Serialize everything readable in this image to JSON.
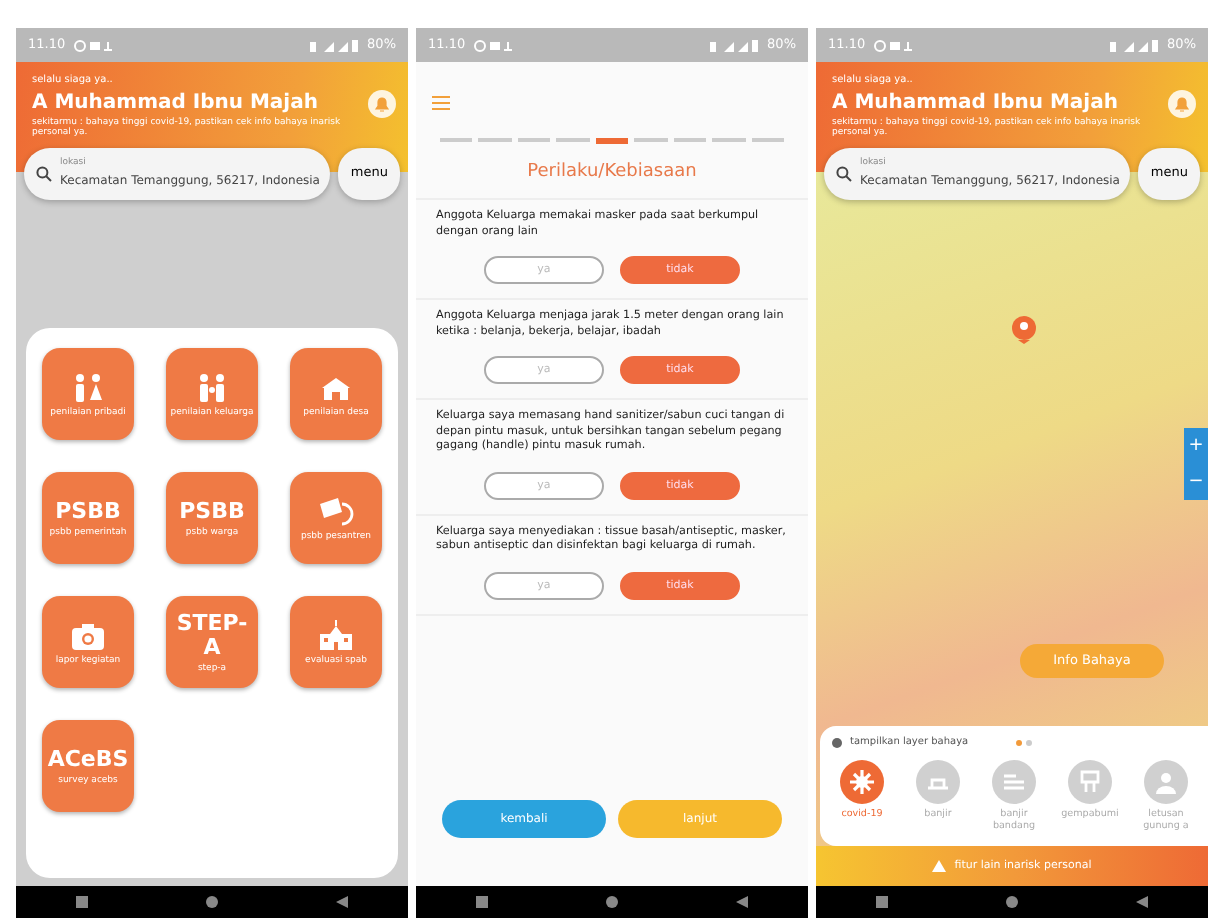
{
  "phones": [
    {
      "kind": "menu",
      "status_bar": {
        "time": "11.10",
        "battery": "80%"
      },
      "header": {
        "greeting": "selalu siaga ya..",
        "name": "A Muhammad Ibnu Majah",
        "description": "sekitarmu : bahaya tinggi covid-19, pastikan cek info bahaya inarisk personal ya."
      },
      "search": {
        "label": "lokasi",
        "value": "Kecamatan Temanggung, 56217, Indonesia",
        "menu_button": "menu"
      },
      "tiles": [
        {
          "kind": "icon",
          "label": "penilaian pribadi"
        },
        {
          "kind": "icon",
          "label": "penilaian keluarga"
        },
        {
          "kind": "icon",
          "label": "penilaian desa"
        },
        {
          "kind": "logo",
          "logo": "PSBB",
          "label": "psbb pemerintah"
        },
        {
          "kind": "logo",
          "logo": "PSBB",
          "label": "psbb warga"
        },
        {
          "kind": "icon",
          "label": "psbb pesantren"
        },
        {
          "kind": "icon",
          "label": "lapor kegiatan"
        },
        {
          "kind": "logo",
          "logo": "STEP-A",
          "label": "step-a"
        },
        {
          "kind": "icon",
          "label": "evaluasi spab"
        },
        {
          "kind": "logo",
          "logo": "ACeBS",
          "label": "survey acebs"
        }
      ]
    },
    {
      "kind": "form",
      "status_bar": {
        "time": "11.10",
        "battery": "80%"
      },
      "steps": [
        {
          "selected": false
        },
        {
          "selected": false
        },
        {
          "selected": false
        },
        {
          "selected": false
        },
        {
          "selected": true
        },
        {
          "selected": false
        },
        {
          "selected": false
        },
        {
          "selected": false
        },
        {
          "selected": false
        }
      ],
      "title": "Perilaku/Kebiasaan",
      "questions": [
        {
          "text": "Anggota Keluarga memakai masker pada saat berkumpul dengan orang lain",
          "options": [
            {
              "label": "ya",
              "selected": false
            },
            {
              "label": "tidak",
              "selected": true
            }
          ]
        },
        {
          "text": "Anggota Keluarga menjaga jarak 1.5 meter dengan orang lain ketika : belanja, bekerja, belajar, ibadah",
          "options": [
            {
              "label": "ya",
              "selected": false
            },
            {
              "label": "tidak",
              "selected": true
            }
          ]
        },
        {
          "text": "Keluarga saya memasang  hand sanitizer/sabun cuci tangan di depan pintu masuk, untuk bersihkan tangan sebelum pegang gagang (handle) pintu masuk rumah.",
          "options": [
            {
              "label": "ya",
              "selected": false
            },
            {
              "label": "tidak",
              "selected": true
            }
          ]
        },
        {
          "text": "Keluarga saya menyediakan : tissue basah/antiseptic, masker, sabun antiseptic dan disinfektan bagi keluarga di rumah.",
          "options": [
            {
              "label": "ya",
              "selected": false
            },
            {
              "label": "tidak",
              "selected": true
            }
          ]
        }
      ],
      "back_button": "kembali",
      "next_button": "lanjut"
    },
    {
      "kind": "map",
      "status_bar": {
        "time": "11.10",
        "battery": "80%"
      },
      "header": {
        "greeting": "selalu siaga ya..",
        "name": "A Muhammad Ibnu Majah",
        "description": "sekitarmu : bahaya tinggi covid-19, pastikan cek info bahaya inarisk personal ya."
      },
      "search": {
        "label": "lokasi",
        "value": "Kecamatan Temanggung, 56217, Indonesia",
        "menu_button": "menu"
      },
      "zoom_in": "+",
      "zoom_out": "−",
      "info_button": "Info Bahaya",
      "layer_panel": {
        "title": "tampilkan layer bahaya",
        "pager_dots": [
          {
            "selected": true
          },
          {
            "selected": false
          }
        ],
        "layers": [
          {
            "label": "covid-19",
            "selected": true
          },
          {
            "label": "banjir",
            "selected": false
          },
          {
            "label": "banjir bandang",
            "selected": false
          },
          {
            "label": "gempabumi",
            "selected": false
          },
          {
            "label": "letusan gunung a",
            "selected": false
          }
        ]
      },
      "footer": "fitur lain inarisk personal"
    }
  ]
}
